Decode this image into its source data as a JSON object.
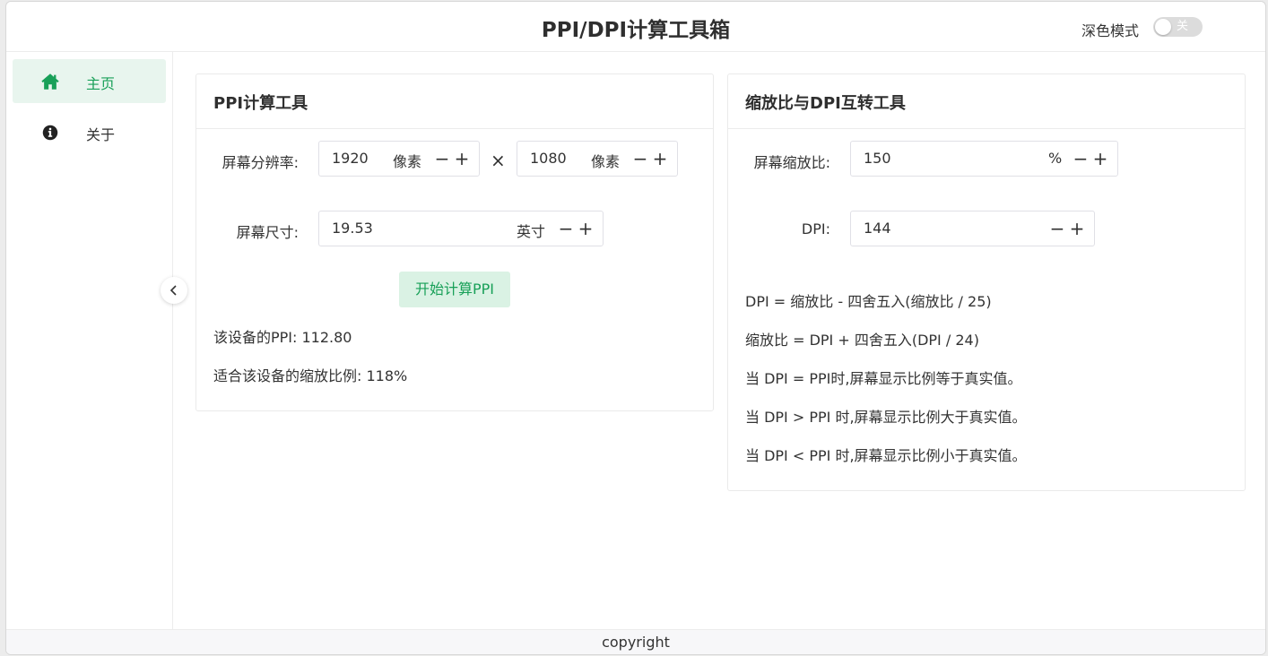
{
  "header": {
    "title": "PPI/DPI计算工具箱",
    "dark_mode_label": "深色模式",
    "toggle_text": "关"
  },
  "sidebar": {
    "items": [
      {
        "label": "主页",
        "icon": "home-icon",
        "active": true
      },
      {
        "label": "关于",
        "icon": "info-icon",
        "active": false
      }
    ]
  },
  "ppi_card": {
    "title": "PPI计算工具",
    "resolution_label": "屏幕分辨率:",
    "width_value": "1920",
    "height_value": "1080",
    "pixel_unit": "像素",
    "times": "×",
    "size_label": "屏幕尺寸:",
    "size_value": "19.53",
    "size_unit": "英寸",
    "calc_button": "开始计算PPI",
    "result_ppi": "该设备的PPI: 112.80",
    "result_scale": "适合该设备的缩放比例: 118%"
  },
  "dpi_card": {
    "title": "缩放比与DPI互转工具",
    "scale_label": "屏幕缩放比:",
    "scale_value": "150",
    "scale_unit": "%",
    "dpi_label": "DPI:",
    "dpi_value": "144",
    "formulas": [
      "DPI = 缩放比 - 四舍五入(缩放比 / 25)",
      "缩放比 = DPI + 四舍五入(DPI / 24)",
      "当 DPI = PPI时,屏幕显示比例等于真实值。",
      "当 DPI > PPI 时,屏幕显示比例大于真实值。",
      "当 DPI < PPI 时,屏幕显示比例小于真实值。"
    ]
  },
  "stepper": {
    "minus": "−",
    "plus": "+"
  },
  "footer": {
    "text": "copyright"
  },
  "colors": {
    "accent": "#18a058",
    "accent_bg": "#e8f5ee",
    "button_bg": "#daf2e4"
  }
}
